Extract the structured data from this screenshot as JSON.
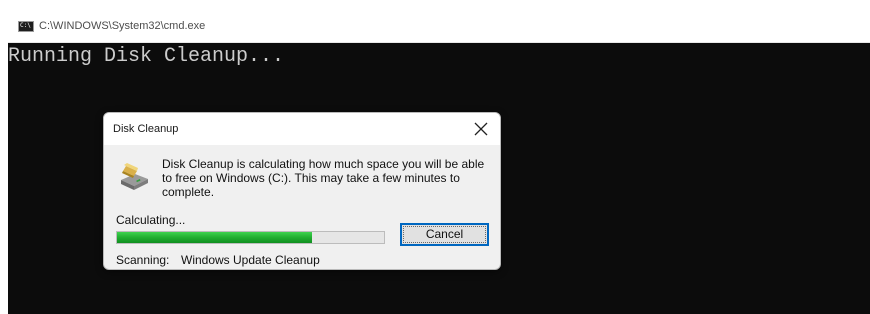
{
  "cmd_window": {
    "title": "C:\\WINDOWS\\System32\\cmd.exe",
    "icon_text": "C:\\",
    "icon": "console-icon",
    "console_output": "Running Disk Cleanup..."
  },
  "dialog": {
    "title": "Disk Cleanup",
    "message": "Disk Cleanup is calculating how much space you will be able to free on Windows (C:). This may take a few minutes to complete.",
    "status_label": "Calculating...",
    "progress_fraction": 0.73,
    "cancel_label": "Cancel",
    "scanning_label": "Scanning:",
    "scanning_value": "Windows Update Cleanup",
    "icons": {
      "close": "close-icon",
      "disk": "disk-cleanup-icon"
    }
  },
  "colors": {
    "console_bg": "#0c0c0c",
    "console_text": "#cccccc",
    "progress_green": "#23b133",
    "button_focus": "#0067c0"
  }
}
